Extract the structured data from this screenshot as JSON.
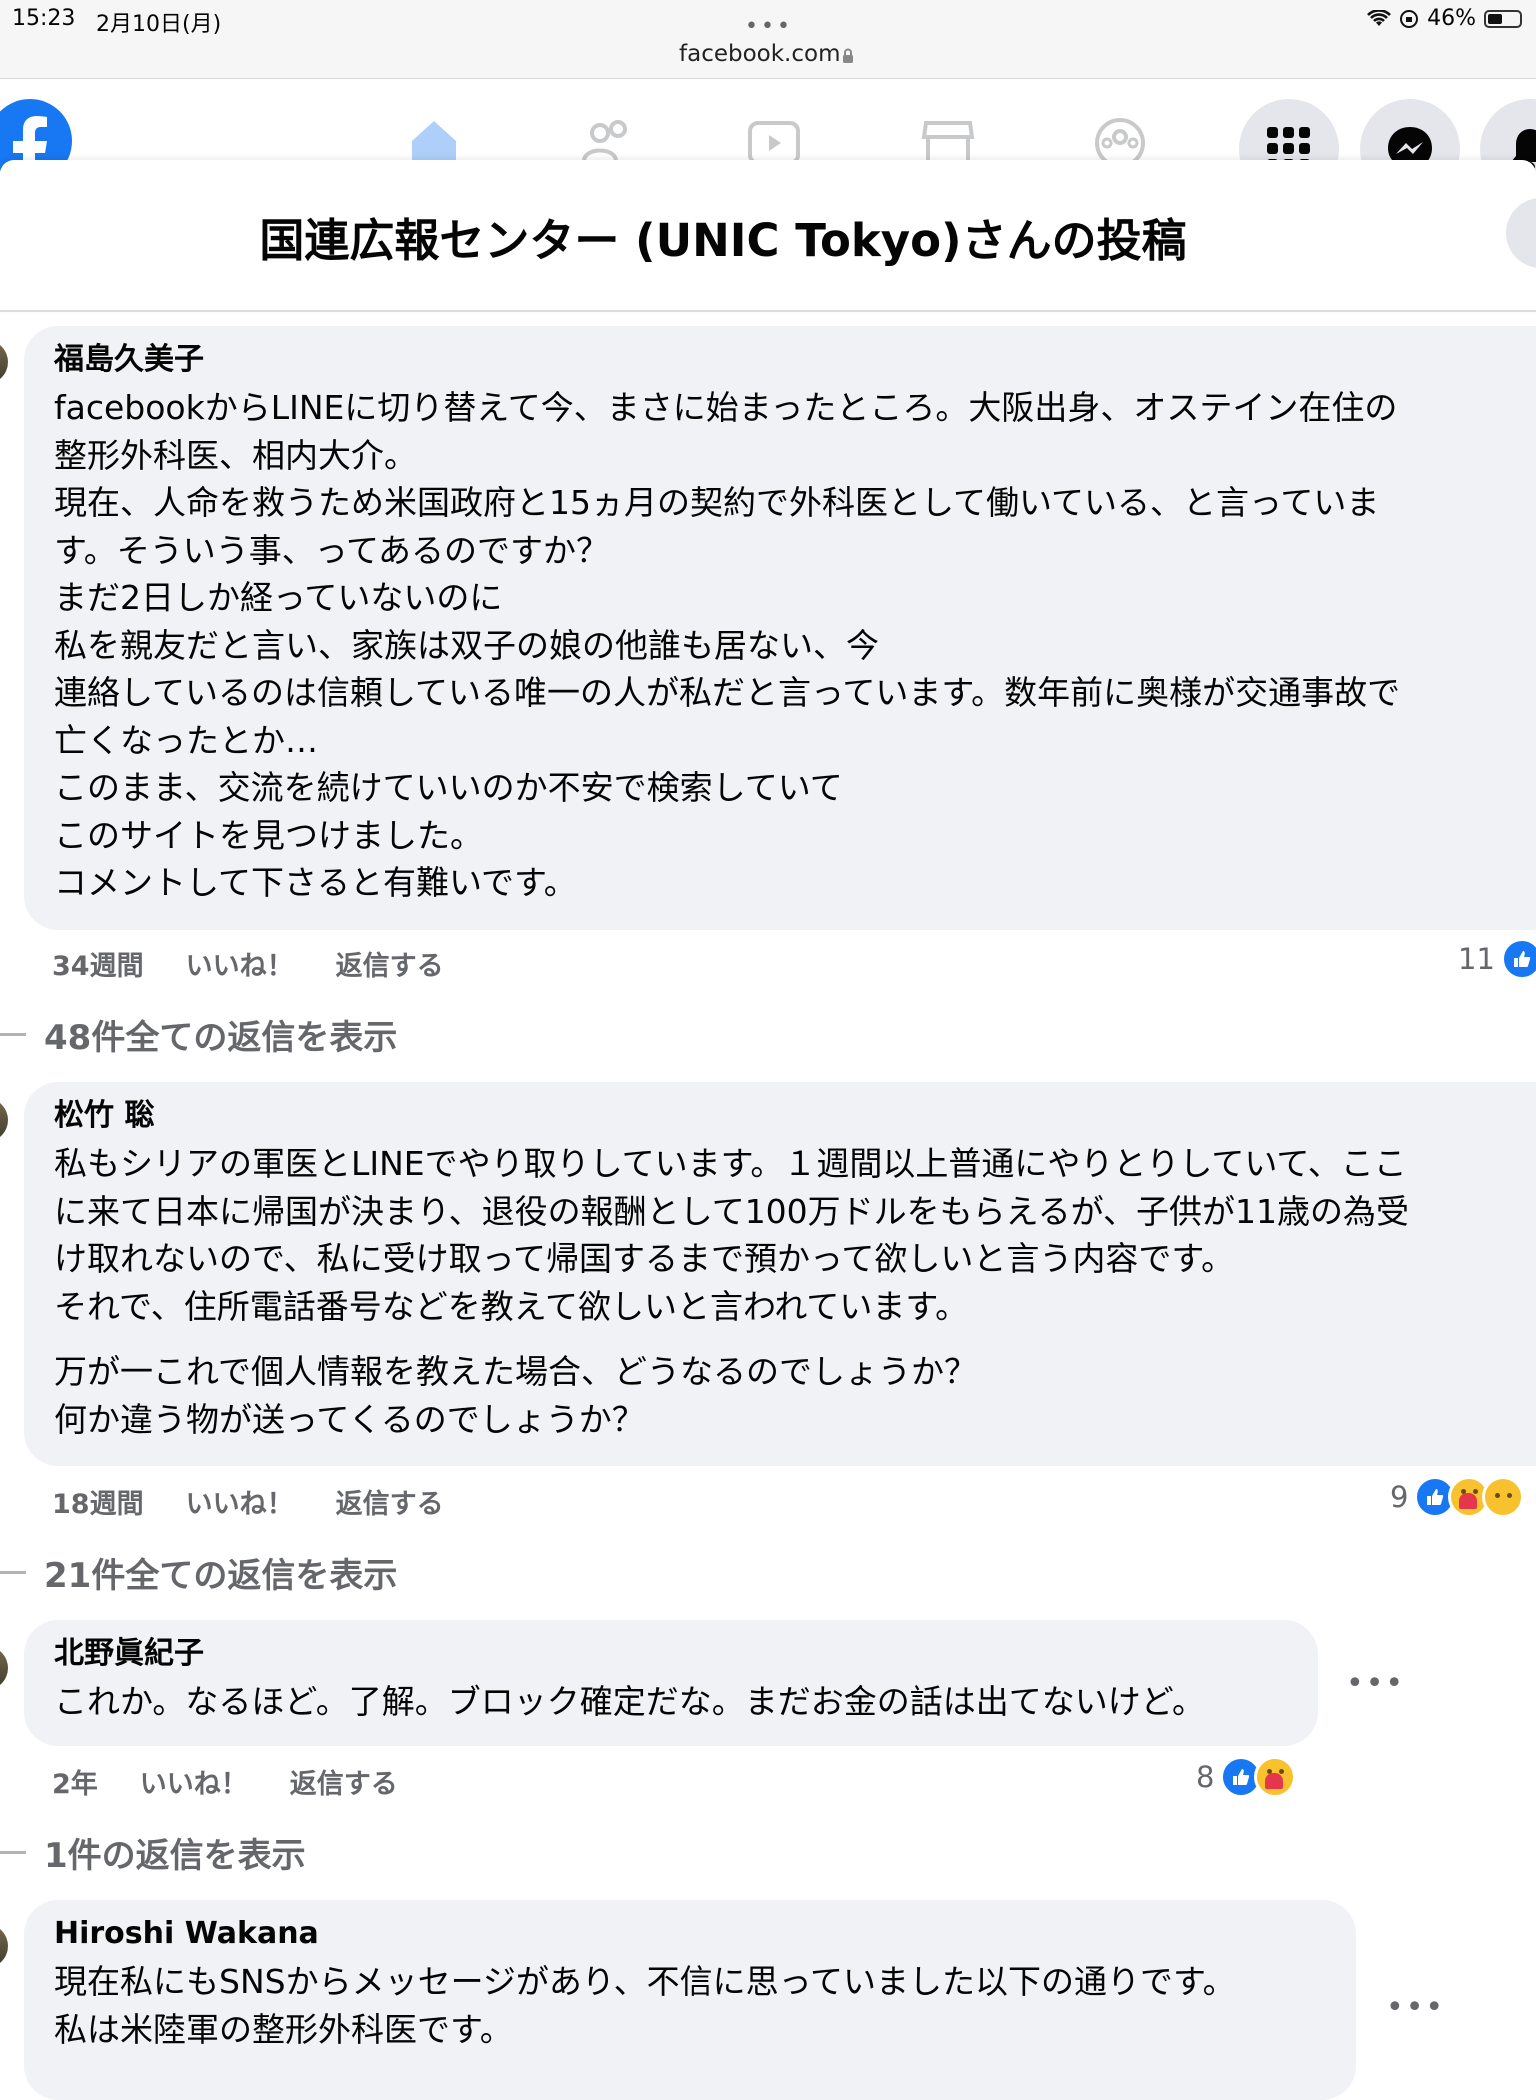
{
  "status_bar": {
    "time": "15:23",
    "date": "2月10日(月)",
    "battery": "46%",
    "battery_level": 0.46
  },
  "browser": {
    "url": "facebook.com"
  },
  "modal": {
    "title": "国連広報センター (UNIC Tokyo)さんの投稿"
  },
  "comments": [
    {
      "author": "福島久美子",
      "lines": [
        "facebookからLINEに切り替えて今、まさに始まったところ。大阪出身、オステイン在住の",
        "整形外科医、相内大介。",
        "現在、人命を救うため米国政府と15ヵ月の契約で外科医として働いている、と言っていま",
        "す。そういう事、ってあるのですか？",
        "まだ2日しか経っていないのに",
        "私を親友だと言い、家族は双子の娘の他誰も居ない、今",
        "連絡しているのは信頼している唯一の人が私だと言っています。数年前に奥様が交通事故で",
        "亡くなったとか…",
        "このまま、交流を続けていいのか不安で検索していて",
        "このサイトを見つけました。",
        "コメントして下さると有難いです。"
      ],
      "time": "34週間",
      "like_label": "いいね！",
      "reply_label": "返信する",
      "reaction_count": "11",
      "view_replies": "48件全ての返信を表示"
    },
    {
      "author": "松竹 聡",
      "lines": [
        "私もシリアの軍医とLINEでやり取りしています。１週間以上普通にやりとりしていて、ここ",
        "に来て日本に帰国が決まり、退役の報酬として100万ドルをもらえるが、子供が11歳の為受",
        "け取れないので、私に受け取って帰国するまで預かって欲しいと言う内容です。",
        "それで、住所電話番号などを教えて欲しいと言われています。"
      ],
      "lines2": [
        "万が一これで個人情報を教えた場合、どうなるのでしょうか？",
        "何か違う物が送ってくるのでしょうか？"
      ],
      "time": "18週間",
      "like_label": "いいね！",
      "reply_label": "返信する",
      "reaction_count": "9",
      "view_replies": "21件全ての返信を表示"
    },
    {
      "author": "北野眞紀子",
      "lines": [
        "これか。なるほど。了解。ブロック確定だな。まだお金の話は出てないけど。"
      ],
      "time": "2年",
      "like_label": "いいね！",
      "reply_label": "返信する",
      "reaction_count": "8",
      "view_replies": "1件の返信を表示"
    },
    {
      "author": "Hiroshi Wakana",
      "lines": [
        "現在私にもSNSからメッセージがあり、不信に思っていました以下の通りです。",
        "私は米陸軍の整形外科医です。"
      ]
    }
  ],
  "icons": {
    "logo": "facebook-logo-icon",
    "nav": [
      "home-icon",
      "friends-icon",
      "video-icon",
      "marketplace-icon",
      "groups-icon"
    ],
    "menu": "grid-menu-icon",
    "messenger": "messenger-icon",
    "notifications": "bell-icon"
  },
  "colors": {
    "brand_blue": "#1877f2",
    "bubble_bg": "#f0f2f5",
    "meta_gray": "#65676b"
  }
}
